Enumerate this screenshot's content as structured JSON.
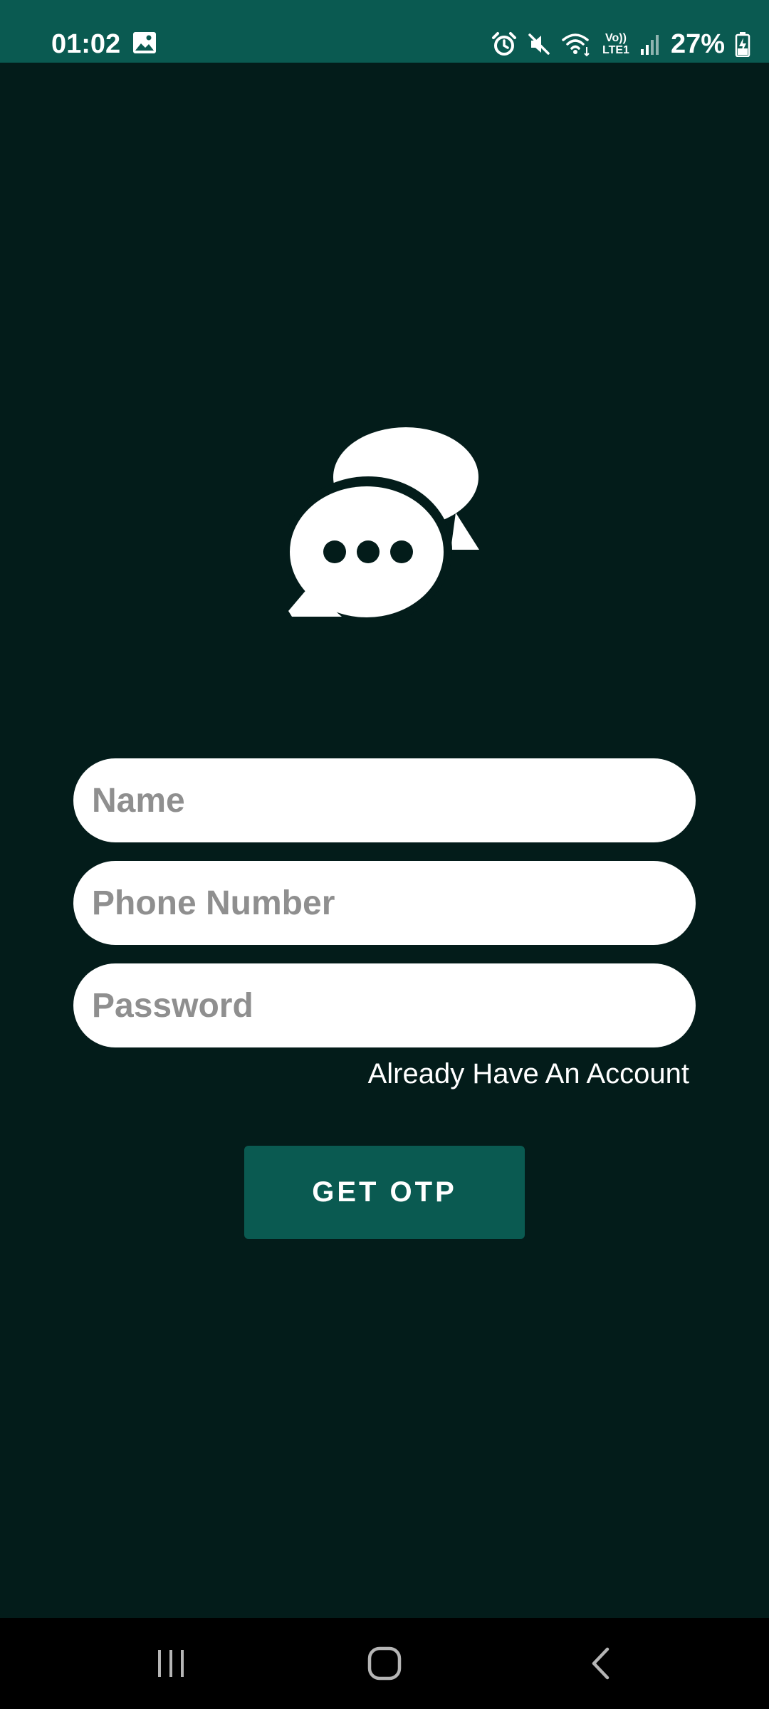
{
  "status_bar": {
    "time": "01:02",
    "battery_percent": "27%",
    "network_label_top": "Vo))",
    "network_label_bottom": "LTE1",
    "icons": [
      "gallery-icon",
      "alarm-icon",
      "mute-icon",
      "wifi-icon",
      "volte-icon",
      "signal-icon",
      "battery-charging-icon"
    ]
  },
  "logo": {
    "icon": "chat-bubbles-icon"
  },
  "form": {
    "name_placeholder": "Name",
    "name_value": "",
    "phone_placeholder": "Phone Number",
    "phone_value": "",
    "password_placeholder": "Password",
    "password_value": ""
  },
  "account_link_label": "Already Have An Account",
  "otp_button_label": "GET OTP",
  "nav_bar": {
    "icons": [
      "recents-icon",
      "home-icon",
      "back-icon"
    ]
  },
  "colors": {
    "background": "#031c1a",
    "accent": "#0a5a51",
    "field_background": "#ffffff",
    "placeholder": "#8f8f8f"
  }
}
